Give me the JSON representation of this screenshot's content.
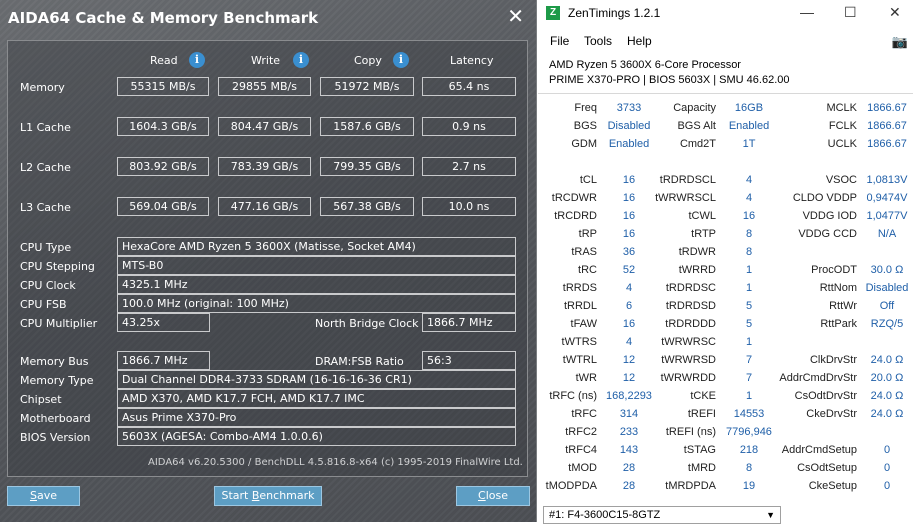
{
  "aida": {
    "title": "AIDA64 Cache & Memory Benchmark",
    "close_glyph": "✕",
    "headers": {
      "read": "Read",
      "write": "Write",
      "copy": "Copy",
      "latency": "Latency",
      "info_glyph": "i"
    },
    "bench_rows": [
      {
        "label": "Memory",
        "read": "55315 MB/s",
        "write": "29855 MB/s",
        "copy": "51972 MB/s",
        "latency": "65.4 ns"
      },
      {
        "label": "L1 Cache",
        "read": "1604.3 GB/s",
        "write": "804.47 GB/s",
        "copy": "1587.6 GB/s",
        "latency": "0.9 ns"
      },
      {
        "label": "L2 Cache",
        "read": "803.92 GB/s",
        "write": "783.39 GB/s",
        "copy": "799.35 GB/s",
        "latency": "2.7 ns"
      },
      {
        "label": "L3 Cache",
        "read": "569.04 GB/s",
        "write": "477.16 GB/s",
        "copy": "567.38 GB/s",
        "latency": "10.0 ns"
      }
    ],
    "info": {
      "cpu_type": {
        "label": "CPU Type",
        "value": "HexaCore AMD Ryzen 5 3600X  (Matisse, Socket AM4)"
      },
      "cpu_stepping": {
        "label": "CPU Stepping",
        "value": "MTS-B0"
      },
      "cpu_clock": {
        "label": "CPU Clock",
        "value": "4325.1 MHz"
      },
      "cpu_fsb": {
        "label": "CPU FSB",
        "value": "100.0 MHz  (original: 100 MHz)"
      },
      "cpu_multiplier": {
        "label": "CPU Multiplier",
        "value": "43.25x"
      },
      "north_bridge_clock": {
        "label": "North Bridge Clock",
        "value": "1866.7 MHz"
      },
      "memory_bus": {
        "label": "Memory Bus",
        "value": "1866.7 MHz"
      },
      "dram_fsb_ratio": {
        "label": "DRAM:FSB Ratio",
        "value": "56:3"
      },
      "memory_type": {
        "label": "Memory Type",
        "value": "Dual Channel DDR4-3733 SDRAM  (16-16-16-36 CR1)"
      },
      "chipset": {
        "label": "Chipset",
        "value": "AMD X370, AMD K17.7 FCH, AMD K17.7 IMC"
      },
      "motherboard": {
        "label": "Motherboard",
        "value": "Asus Prime X370-Pro"
      },
      "bios_version": {
        "label": "BIOS Version",
        "value": "5603X  (AGESA: Combo-AM4 1.0.0.6)"
      }
    },
    "footer": "AIDA64 v6.20.5300 / BenchDLL 4.5.816.8-x64  (c) 1995-2019 FinalWire Ltd.",
    "buttons": {
      "save_hotkey": "S",
      "save_rest": "ave",
      "start_pre": "Start ",
      "start_hotkey": "B",
      "start_rest": "enchmark",
      "close_hotkey": "C",
      "close_rest": "lose"
    }
  },
  "zen": {
    "logo_glyph": "Z",
    "title": "ZenTimings 1.2.1",
    "window_controls": {
      "minimize": "—",
      "maximize": "☐",
      "close": "✕"
    },
    "menu": [
      "File",
      "Tools",
      "Help"
    ],
    "camera_glyph": "📷",
    "processor": "AMD Ryzen 5 3600X 6-Core Processor",
    "board": "PRIME X370-PRO | BIOS 5603X | SMU 46.62.00",
    "col1": [
      [
        "Freq",
        "3733"
      ],
      [
        "BGS",
        "Disabled"
      ],
      [
        "GDM",
        "Enabled"
      ],
      [
        "",
        ""
      ],
      [
        "tCL",
        "16"
      ],
      [
        "tRCDWR",
        "16"
      ],
      [
        "tRCDRD",
        "16"
      ],
      [
        "tRP",
        "16"
      ],
      [
        "tRAS",
        "36"
      ],
      [
        "tRC",
        "52"
      ],
      [
        "tRRDS",
        "4"
      ],
      [
        "tRRDL",
        "6"
      ],
      [
        "tFAW",
        "16"
      ],
      [
        "tWTRS",
        "4"
      ],
      [
        "tWTRL",
        "12"
      ],
      [
        "tWR",
        "12"
      ],
      [
        "tRFC (ns)",
        "168,2293"
      ],
      [
        "tRFC",
        "314"
      ],
      [
        "tRFC2",
        "233"
      ],
      [
        "tRFC4",
        "143"
      ],
      [
        "tMOD",
        "28"
      ],
      [
        "tMODPDA",
        "28"
      ]
    ],
    "col2": [
      [
        "Capacity",
        "16GB"
      ],
      [
        "BGS Alt",
        "Enabled"
      ],
      [
        "Cmd2T",
        "1T"
      ],
      [
        "",
        ""
      ],
      [
        "tRDRDSCL",
        "4"
      ],
      [
        "tWRWRSCL",
        "4"
      ],
      [
        "tCWL",
        "16"
      ],
      [
        "tRTP",
        "8"
      ],
      [
        "tRDWR",
        "8"
      ],
      [
        "tWRRD",
        "1"
      ],
      [
        "tRDRDSC",
        "1"
      ],
      [
        "tRDRDSD",
        "5"
      ],
      [
        "tRDRDDD",
        "5"
      ],
      [
        "tWRWRSC",
        "1"
      ],
      [
        "tWRWRSD",
        "7"
      ],
      [
        "tWRWRDD",
        "7"
      ],
      [
        "tCKE",
        "1"
      ],
      [
        "tREFI",
        "14553"
      ],
      [
        "tREFI (ns)",
        "7796,946"
      ],
      [
        "tSTAG",
        "218"
      ],
      [
        "tMRD",
        "8"
      ],
      [
        "tMRDPDA",
        "19"
      ]
    ],
    "col3": [
      [
        "MCLK",
        "1866.67"
      ],
      [
        "FCLK",
        "1866.67"
      ],
      [
        "UCLK",
        "1866.67"
      ],
      [
        "",
        ""
      ],
      [
        "VSOC",
        "1,0813V"
      ],
      [
        "CLDO VDDP",
        "0,9474V"
      ],
      [
        "VDDG IOD",
        "1,0477V"
      ],
      [
        "VDDG CCD",
        "N/A"
      ],
      [
        "",
        ""
      ],
      [
        "ProcODT",
        "30.0 Ω"
      ],
      [
        "RttNom",
        "Disabled"
      ],
      [
        "RttWr",
        "Off"
      ],
      [
        "RttPark",
        "RZQ/5"
      ],
      [
        "",
        ""
      ],
      [
        "ClkDrvStr",
        "24.0 Ω"
      ],
      [
        "AddrCmdDrvStr",
        "20.0 Ω"
      ],
      [
        "CsOdtDrvStr",
        "24.0 Ω"
      ],
      [
        "CkeDrvStr",
        "24.0 Ω"
      ],
      [
        "",
        ""
      ],
      [
        "AddrCmdSetup",
        "0"
      ],
      [
        "CsOdtSetup",
        "0"
      ],
      [
        "CkeSetup",
        "0"
      ]
    ],
    "dimm_select": "#1: F4-3600C15-8GTZ",
    "dropdown_glyph": "▼"
  }
}
